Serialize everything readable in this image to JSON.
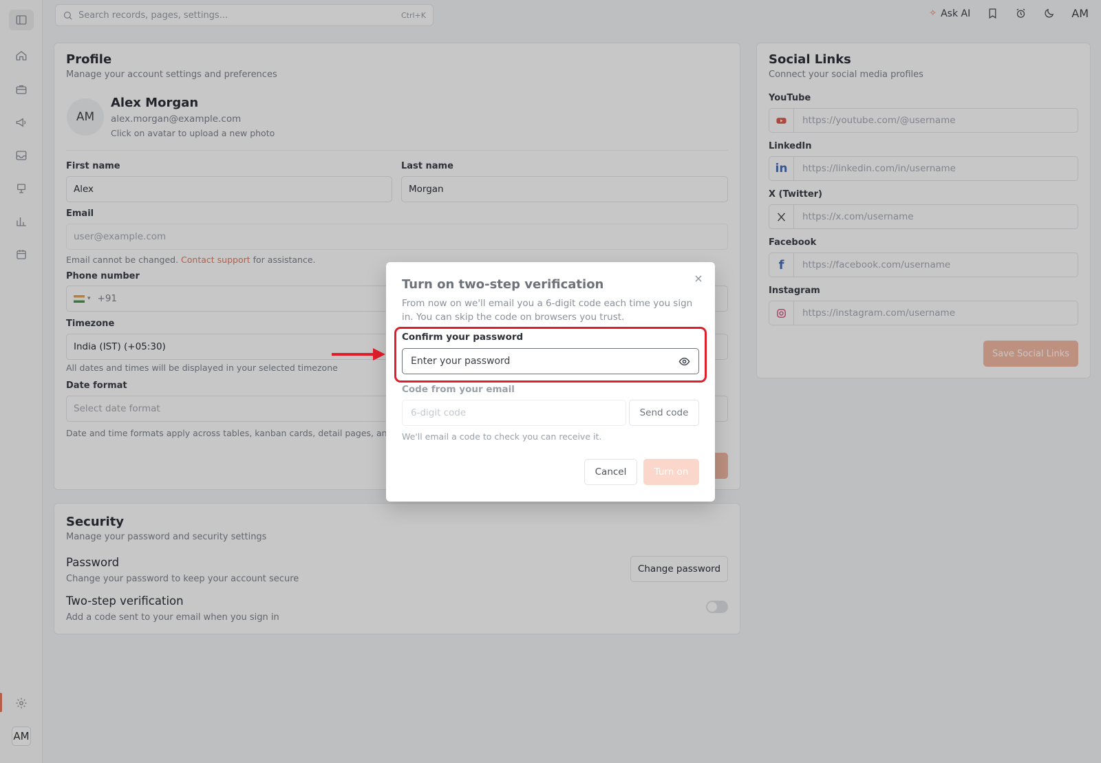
{
  "topbar": {
    "search_placeholder": "Search records, pages, settings...",
    "search_shortcut": "Ctrl+K",
    "ask_ai": "Ask AI",
    "avatar": "AM"
  },
  "sidebar": {
    "avatar": "AM"
  },
  "profile": {
    "title": "Profile",
    "subtitle": "Manage your account settings and preferences",
    "avatar": "AM",
    "name": "Alex Morgan",
    "email": "alex.morgan@example.com",
    "avatar_hint": "Click on avatar to upload a new photo",
    "first_name_label": "First name",
    "first_name_value": "Alex",
    "last_name_label": "Last name",
    "last_name_value": "Morgan",
    "email_label": "Email",
    "email_placeholder": "user@example.com",
    "email_note_before": "Email cannot be changed. ",
    "email_note_link": "Contact support",
    "email_note_after": " for assistance.",
    "phone_label": "Phone number",
    "phone_code": "+91",
    "timezone_label": "Timezone",
    "timezone_value": "India (IST) (+05:30)",
    "timezone_note": "All dates and times will be displayed in your selected timezone",
    "date_format_label": "Date format",
    "date_format_placeholder": "Select date format",
    "date_format_note": "Date and time formats apply across tables, kanban cards, detail pages, and"
  },
  "security": {
    "title": "Security",
    "subtitle": "Manage your password and security settings",
    "password_title": "Password",
    "password_sub": "Change your password to keep your account secure",
    "change_password": "Change password",
    "twostep_title": "Two-step verification",
    "twostep_sub": "Add a code sent to your email when you sign in"
  },
  "social": {
    "title": "Social Links",
    "subtitle": "Connect your social media profiles",
    "youtube_label": "YouTube",
    "youtube_ph": "https://youtube.com/@username",
    "linkedin_label": "LinkedIn",
    "linkedin_ph": "https://linkedin.com/in/username",
    "x_label": "X (Twitter)",
    "x_ph": "https://x.com/username",
    "facebook_label": "Facebook",
    "facebook_ph": "https://facebook.com/username",
    "instagram_label": "Instagram",
    "instagram_ph": "https://instagram.com/username",
    "save": "Save Social Links"
  },
  "modal": {
    "title": "Turn on two-step verification",
    "description": "From now on we'll email you a 6-digit code each time you sign in. You can skip the code on browsers you trust.",
    "password_label": "Confirm your password",
    "password_placeholder": "Enter your password",
    "code_label": "Code from your email",
    "code_placeholder": "6-digit code",
    "send_code": "Send code",
    "hint": "We'll email a code to check you can receive it.",
    "cancel": "Cancel",
    "turn_on": "Turn on"
  },
  "colors": {
    "accent": "#e8795c",
    "highlight": "#e01e2a"
  }
}
